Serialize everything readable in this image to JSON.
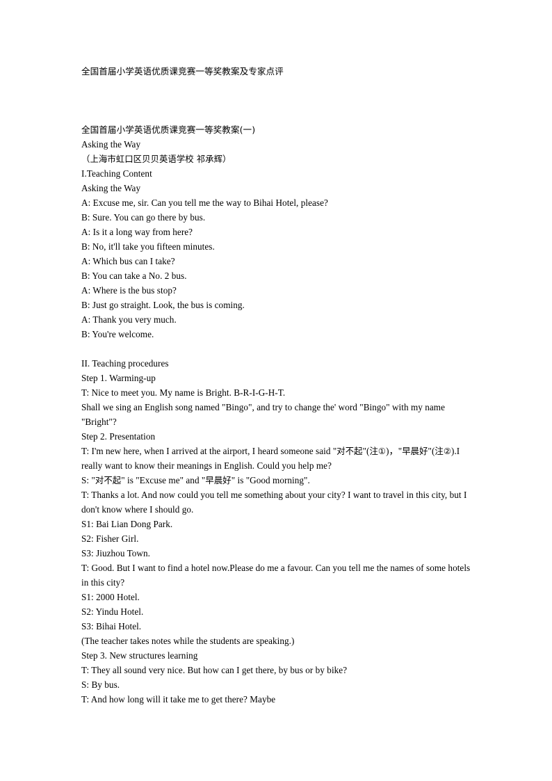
{
  "document": {
    "title": "全国首届小学英语优质课竞赛一等奖教案及专家点评",
    "section_heading": "全国首届小学英语优质课竞赛一等奖教案(一)",
    "lesson_title": "Asking the Way",
    "byline": "（上海市虹口区贝贝英语学校 祁承辉）",
    "content_heading": "I.Teaching Content",
    "dialogue_title": "Asking the Way",
    "dialogue": [
      "A: Excuse me, sir. Can you tell me the way to Bihai Hotel, please?",
      "B: Sure. You can go there by bus.",
      "A: Is it a long way from here?",
      "B: No, it'll take you fifteen minutes.",
      "A: Which bus can I take?",
      "B: You can take a No. 2 bus.",
      "A: Where is the bus stop?",
      "B: Just go straight. Look, the bus is coming.",
      "A: Thank you very much.",
      "B: You're welcome."
    ],
    "procedures_heading": "II. Teaching procedures",
    "step1_heading": "Step 1. Warming-up",
    "step1_lines": [
      "T: Nice to meet you. My name is Bright. B-R-I-G-H-T.",
      "Shall we sing an English song named \"Bingo\", and try to change the' word \"Bingo\" with my name \"Bright\"?"
    ],
    "step2_heading": "Step 2. Presentation",
    "step2_line1_a": "T: I'm new here, when I arrived at the airport, I heard someone said \"",
    "step2_line1_cjk1": "对不起",
    "step2_line1_b": "\"(",
    "step2_line1_cjk2": "注①",
    "step2_line1_c": ")，\"",
    "step2_line1_cjk3": "早晨好",
    "step2_line1_d": "\"(",
    "step2_line1_cjk4": "注②",
    "step2_line1_e": ").I really want to know their meanings in English. Could you help me?",
    "step2_line2_a": "S: \"",
    "step2_line2_cjk1": "对不起",
    "step2_line2_b": "\" is \"Excuse me\" and \"",
    "step2_line2_cjk2": "早晨好",
    "step2_line2_c": "\" is \"Good morning\".",
    "step2_rest": [
      "T: Thanks a lot. And now could you tell me something about your city? I want to travel in this city, but I don't know where I should go.",
      "S1: Bai Lian Dong Park.",
      "S2: Fisher Girl.",
      "S3: Jiuzhou Town.",
      "T: Good. But I want to find a hotel now.Please do me a favour. Can you tell me the names of some hotels in this city?",
      "S1: 2000 Hotel.",
      "S2: Yindu Hotel.",
      "S3: Bihai Hotel.",
      "(The teacher takes notes while the students are speaking.)"
    ],
    "step3_heading": "Step 3. New structures learning",
    "step3_lines": [
      "T: They all sound very nice. But how can I get there, by bus or by bike?",
      "S: By bus.",
      "T: And how long will it take me to get there? Maybe"
    ]
  }
}
